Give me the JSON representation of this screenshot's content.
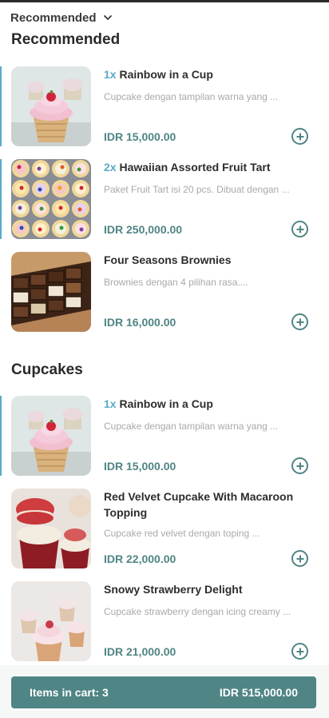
{
  "category_select": {
    "label": "Recommended"
  },
  "sections": [
    {
      "title": "Recommended",
      "items": [
        {
          "qty": "1x",
          "name": "Rainbow in a Cup",
          "desc": "Cupcake dengan tampilan warna yang ...",
          "price": "IDR 15,000.00",
          "image": "cupcake-rainbow"
        },
        {
          "qty": "2x",
          "name": "Hawaiian Assorted Fruit Tart",
          "desc": "Paket Fruit Tart isi 20 pcs. Dibuat dengan ...",
          "price": "IDR 250,000.00",
          "image": "fruit-tarts"
        },
        {
          "qty": "",
          "name": "Four Seasons Brownies",
          "desc": "Brownies dengan 4 pilihan rasa....",
          "price": "IDR 16,000.00",
          "image": "brownies"
        }
      ]
    },
    {
      "title": "Cupcakes",
      "items": [
        {
          "qty": "1x",
          "name": "Rainbow in a Cup",
          "desc": "Cupcake dengan tampilan warna yang ...",
          "price": "IDR 15,000.00",
          "image": "cupcake-rainbow"
        },
        {
          "qty": "",
          "name": "Red Velvet Cupcake With Macaroon Topping",
          "desc": "Cupcake red velvet dengan toping ...",
          "price": "IDR 22,000.00",
          "image": "red-velvet"
        },
        {
          "qty": "",
          "name": "Snowy Strawberry Delight",
          "desc": "Cupcake strawberry dengan icing creamy ...",
          "price": "IDR 21,000.00",
          "image": "strawberry-cupcakes"
        }
      ]
    }
  ],
  "cart": {
    "label": "Items in cart: 3",
    "total": "IDR 515,000.00"
  },
  "colors": {
    "accent": "#4f8584",
    "qty": "#5aa9c9"
  },
  "icons": {
    "chevron": "chevron-down-icon",
    "add": "plus-circle-icon"
  }
}
